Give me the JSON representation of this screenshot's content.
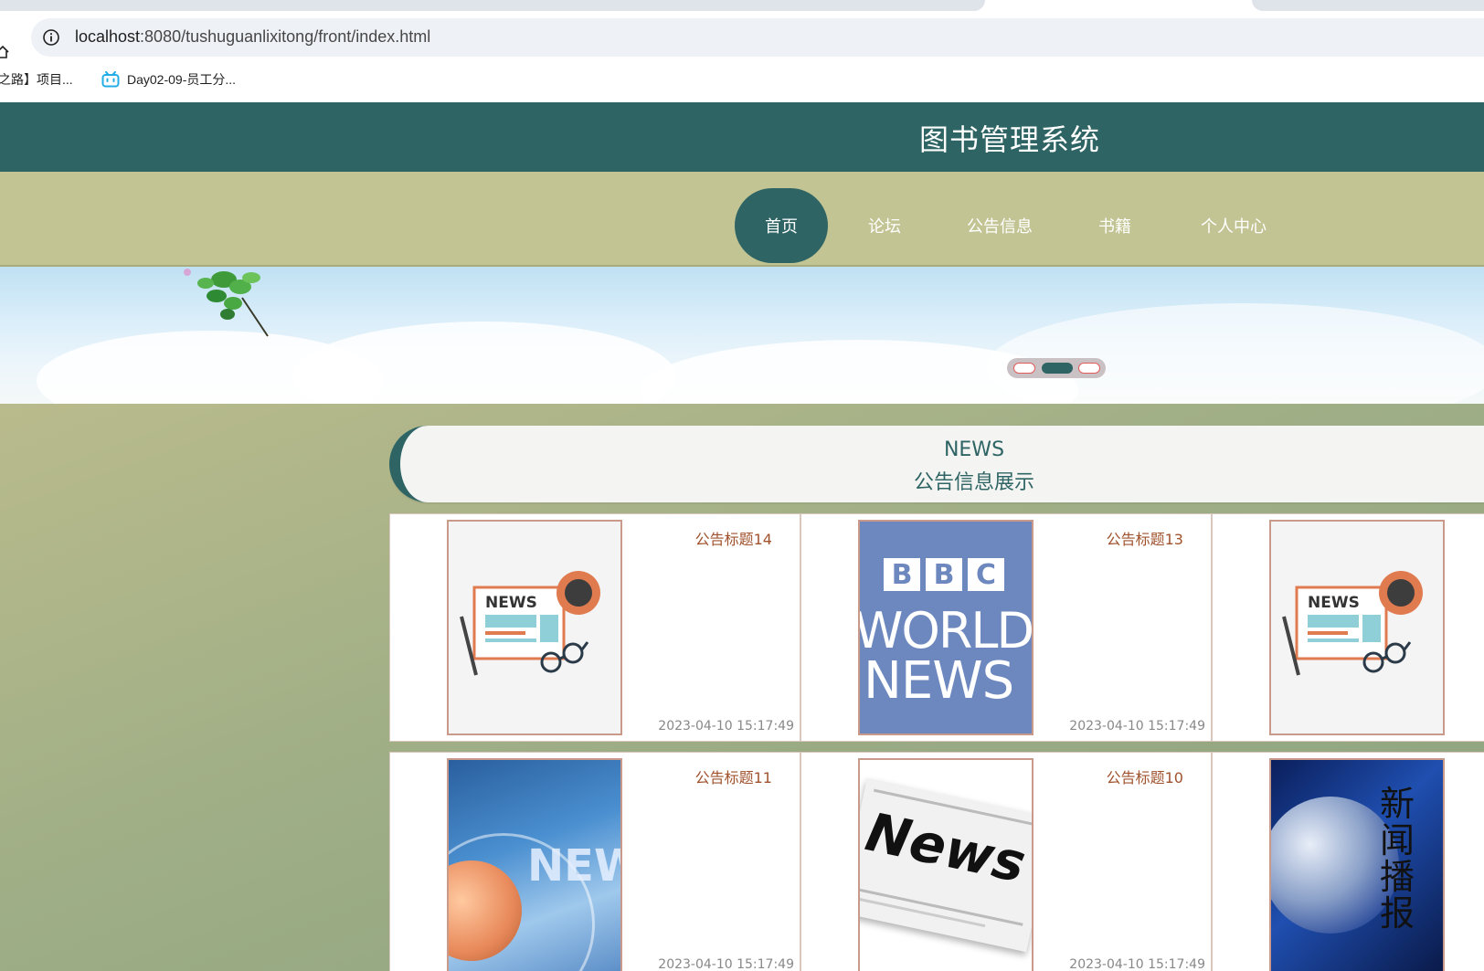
{
  "browser": {
    "url_host": "localhost",
    "url_path": ":8080/tushuguanlixitong/front/index.html",
    "bookmarks": [
      {
        "label": "之路】项目..."
      },
      {
        "label": "Day02-09-员工分..."
      }
    ]
  },
  "site": {
    "title": "图书管理系统"
  },
  "nav": {
    "items": [
      {
        "label": "首页"
      },
      {
        "label": "论坛"
      },
      {
        "label": "公告信息"
      },
      {
        "label": "书籍"
      },
      {
        "label": "个人中心"
      }
    ],
    "active_index": 0
  },
  "carousel": {
    "active_dot": 2,
    "dot_count": 3
  },
  "news_section": {
    "heading_en": "NEWS",
    "heading_cn": "公告信息展示",
    "cards": [
      {
        "title": "公告标题14",
        "date": "2023-04-10 15:17:49",
        "image": "news-illustration"
      },
      {
        "title": "公告标题13",
        "date": "2023-04-10 15:17:49",
        "image": "bbc-world-news",
        "image_text": [
          "BBC",
          "WORLD",
          "NEWS"
        ]
      },
      {
        "title": "",
        "date": "",
        "image": "news-illustration"
      },
      {
        "title": "公告标题11",
        "date": "2023-04-10 15:17:49",
        "image": "globe-news-blue",
        "image_text": [
          "NEW"
        ]
      },
      {
        "title": "公告标题10",
        "date": "2023-04-10 15:17:49",
        "image": "newspaper",
        "image_text": [
          "News"
        ]
      },
      {
        "title": "",
        "date": "",
        "image": "globe-news-broadcast",
        "image_text": [
          "新",
          "闻",
          "播",
          "报"
        ]
      }
    ]
  },
  "colors": {
    "primary": "#2e6464",
    "nav_bg": "#c2c494",
    "card_title": "#a0522d"
  }
}
